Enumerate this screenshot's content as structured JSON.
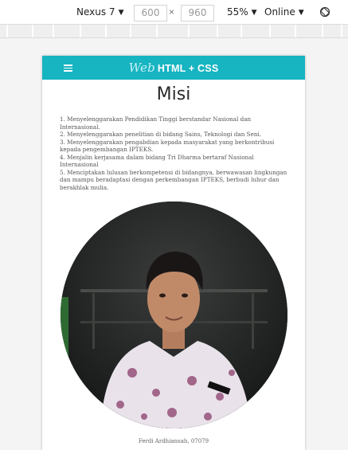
{
  "devtools": {
    "device": "Nexus 7",
    "width": "600",
    "times": "×",
    "height": "960",
    "zoom": "55%",
    "network": "Online",
    "arrow": "▼"
  },
  "site": {
    "brand_prefix": "Web",
    "brand_rest": "HTML + CSS",
    "title": "Misi",
    "misi_items": [
      "1. Menyelenggarakan Pendidikan Tinggi berstandar Nasional dan Internasional.",
      "2. Menyelenggarakan penelitian di bidang Sains, Teknologi dan Seni.",
      "3. Menyelenggarakan pengabdian kepada masyarakat yang berkontribusi kepada pengembangan IPTEKS.",
      "4. Menjalin kerjasama dalam bidang Tri Dharma bertaraf Nasional Internasional",
      "5. Menciptakan lulusan berkompetensi di bidangnya, berwawasan lingkungan dan mampu beradaptasi dengan perkembangan IPTEKS, berbudi luhur dan berakhlak mulia."
    ],
    "caption": "Ferdi Ardhiansah, 07079"
  },
  "colors": {
    "nav": "#17b4c1"
  }
}
